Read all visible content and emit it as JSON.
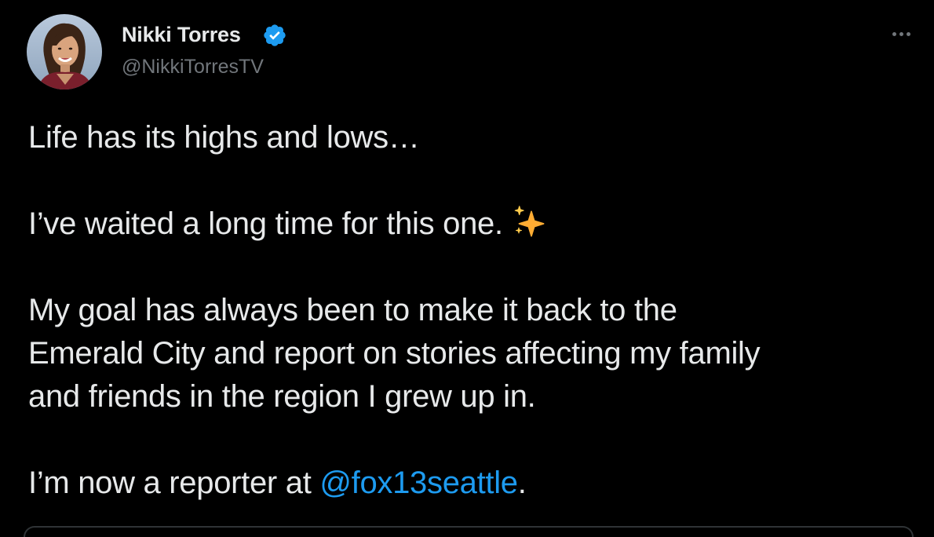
{
  "author": {
    "name": "Nikki Torres",
    "handle": "@NikkiTorresTV",
    "verified": true,
    "avatar_icon": "profile-photo"
  },
  "tweet": {
    "line1": "Life has its highs and lows…",
    "line2": "I’ve waited a long time for this one.",
    "line2_emoji": "sparkles-icon",
    "line3": "My goal has always been to make it back to the",
    "line4": "Emerald City and report on stories affecting my family",
    "line5": "and friends in the region I grew up in.",
    "line6_prefix": "I’m now a reporter at ",
    "line6_mention": "@fox13seattle",
    "line6_suffix": "."
  },
  "colors": {
    "background": "#000000",
    "text": "#e7e9ea",
    "muted": "#71767b",
    "accent": "#1d9bf0",
    "sparkle": "#ffac33"
  },
  "menu": {
    "more_icon": "more-horizontal-icon"
  }
}
